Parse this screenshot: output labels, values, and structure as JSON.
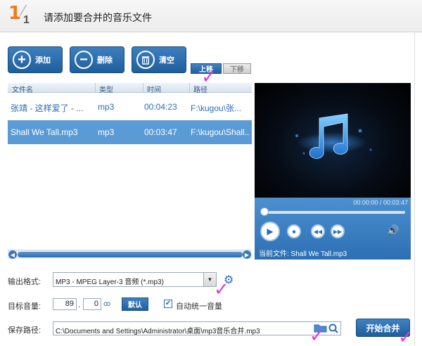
{
  "header": {
    "step_number": "1",
    "step_total": "1",
    "title": "请添加要合并的音乐文件"
  },
  "toolbar": {
    "add_label": "添加",
    "delete_label": "删除",
    "clear_label": "清空",
    "move_up_label": "上移",
    "move_down_label": "下移"
  },
  "file_list": {
    "columns": [
      "文件名",
      "类型",
      "时间",
      "路径"
    ],
    "rows": [
      {
        "name": "张靖 - 这样爱了 - ...",
        "type": "mp3",
        "duration": "00:04:23",
        "path": "F:\\kugou\\张..."
      },
      {
        "name": "Shall We Tall.mp3",
        "type": "mp3",
        "duration": "00:03:47",
        "path": "F:\\kugou\\Shall..."
      }
    ],
    "selected_index": 1
  },
  "player": {
    "time": "00:00:00 / 00:03:47",
    "progress": 0,
    "current_file": "当前文件: Shall We Tall.mp3"
  },
  "settings": {
    "format_label": "输出格式:",
    "format_value": "MP3 - MPEG Layer-3 音频 (*.mp3)",
    "volume_label": "目标音量:",
    "volume_int": "89",
    "volume_dec": "0",
    "volume_sep": ".",
    "default_label": "默认",
    "auto_volume_label": "自动统一音量",
    "auto_volume_checked": true,
    "path_label": "保存路径:",
    "path_value": "C:\\Documents and Settings\\Administrator\\桌面\\mp3音乐合并.mp3",
    "start_label": "开始合并"
  },
  "colors": {
    "accent": "#2d6eb0",
    "selection": "#5b9bd5",
    "step": "#ee7a1d",
    "annotation": "#e03bd3"
  }
}
